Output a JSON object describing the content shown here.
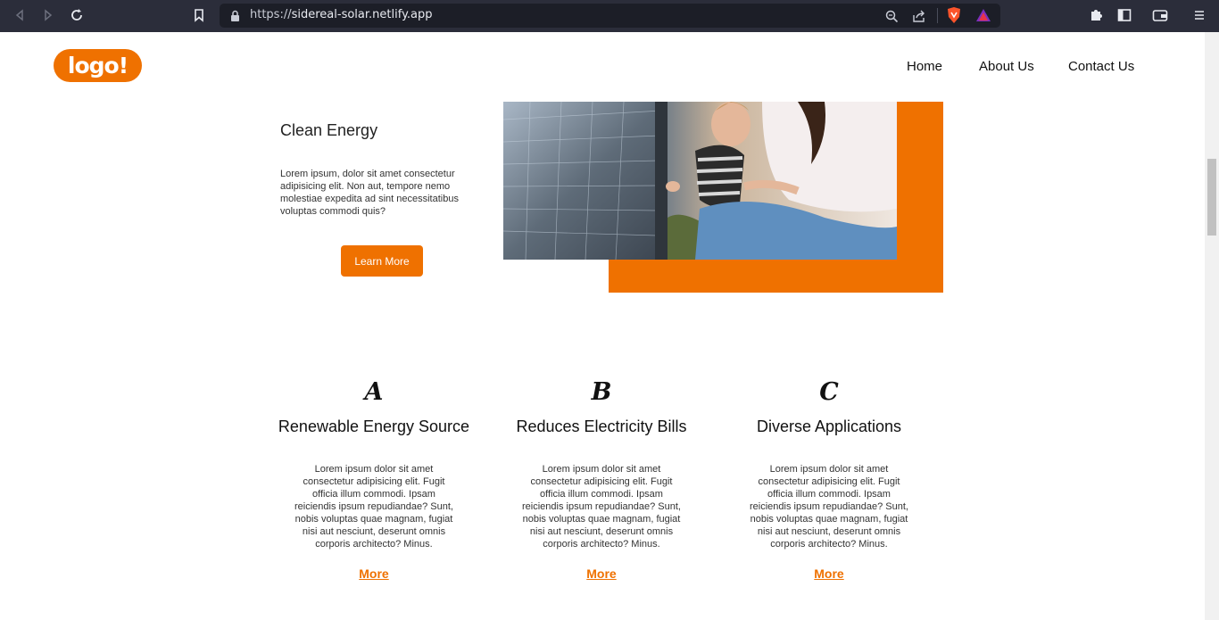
{
  "browser": {
    "url_scheme": "https://",
    "url_host": "sidereal-solar.netlify.app",
    "icons": [
      "back-icon",
      "forward-icon",
      "reload-icon",
      "bookmark-icon",
      "lock-icon",
      "zoom-icon",
      "share-icon",
      "brave-shield-icon",
      "brave-rewards-icon",
      "extensions-icon",
      "sidebar-icon",
      "wallet-icon",
      "menu-icon"
    ]
  },
  "header": {
    "logo_text": "logo!",
    "nav": [
      "Home",
      "About Us",
      "Contact Us"
    ]
  },
  "hero": {
    "title": "Clean Energy",
    "text": "Lorem ipsum, dolor sit amet consectetur adipisicing elit. Non aut, tempore nemo molestiae expedita ad sint necessitatibus voluptas commodi quis?",
    "button": "Learn More"
  },
  "features": [
    {
      "letter": "A",
      "title": "Renewable Energy Source",
      "text": "Lorem ipsum dolor sit amet consectetur adipisicing elit. Fugit officia illum commodi. Ipsam reiciendis ipsum repudiandae? Sunt, nobis voluptas quae magnam, fugiat nisi aut nesciunt, deserunt omnis corporis architecto? Minus.",
      "more": "More"
    },
    {
      "letter": "B",
      "title": "Reduces Electricity Bills",
      "text": "Lorem ipsum dolor sit amet consectetur adipisicing elit. Fugit officia illum commodi. Ipsam reiciendis ipsum repudiandae? Sunt, nobis voluptas quae magnam, fugiat nisi aut nesciunt, deserunt omnis corporis architecto? Minus.",
      "more": "More"
    },
    {
      "letter": "C",
      "title": "Diverse Applications",
      "text": "Lorem ipsum dolor sit amet consectetur adipisicing elit. Fugit officia illum commodi. Ipsam reiciendis ipsum repudiandae? Sunt, nobis voluptas quae magnam, fugiat nisi aut nesciunt, deserunt omnis corporis architecto? Minus.",
      "more": "More"
    }
  ],
  "colors": {
    "accent": "#ef7100",
    "chrome_bg": "#2b2d3a",
    "urlbar_bg": "#1c1e27"
  }
}
